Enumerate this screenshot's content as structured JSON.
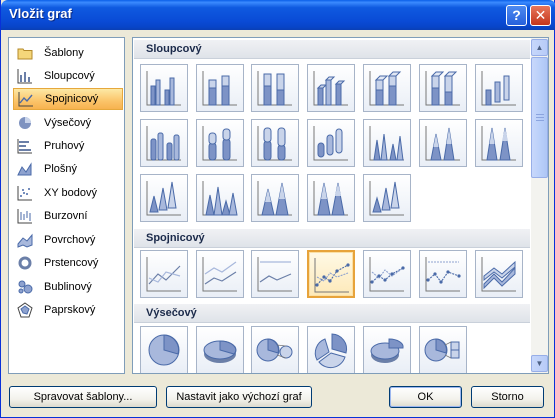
{
  "window": {
    "title": "Vložit graf"
  },
  "titlebar": {
    "help_glyph": "?",
    "close_glyph": "✕"
  },
  "sidebar": {
    "items": [
      {
        "label": "Šablony",
        "icon": "folder-icon"
      },
      {
        "label": "Sloupcový",
        "icon": "column-chart-icon"
      },
      {
        "label": "Spojnicový",
        "icon": "line-chart-icon",
        "selected": true
      },
      {
        "label": "Výsečový",
        "icon": "pie-chart-icon"
      },
      {
        "label": "Pruhový",
        "icon": "bar-chart-icon"
      },
      {
        "label": "Plošný",
        "icon": "area-chart-icon"
      },
      {
        "label": "XY bodový",
        "icon": "scatter-chart-icon"
      },
      {
        "label": "Burzovní",
        "icon": "stock-chart-icon"
      },
      {
        "label": "Povrchový",
        "icon": "surface-chart-icon"
      },
      {
        "label": "Prstencový",
        "icon": "doughnut-chart-icon"
      },
      {
        "label": "Bublinový",
        "icon": "bubble-chart-icon"
      },
      {
        "label": "Paprskový",
        "icon": "radar-chart-icon"
      }
    ]
  },
  "gallery": {
    "sections": [
      {
        "title": "Sloupcový",
        "tiles": [
          "clustered-column-icon",
          "stacked-column-icon",
          "100-stacked-column-icon",
          "3d-clustered-column-icon",
          "3d-stacked-column-icon",
          "3d-100-stacked-column-icon",
          "3d-column-icon",
          "clustered-cylinder-icon",
          "stacked-cylinder-icon",
          "100-stacked-cylinder-icon",
          "3d-cylinder-icon",
          "clustered-cone-icon",
          "stacked-cone-icon",
          "100-stacked-cone-icon",
          "3d-cone-icon",
          "clustered-pyramid-icon",
          "stacked-pyramid-icon",
          "100-stacked-pyramid-icon",
          "3d-pyramid-icon"
        ]
      },
      {
        "title": "Spojnicový",
        "tiles": [
          "line-icon",
          "stacked-line-icon",
          "100-stacked-line-icon",
          "line-with-markers-icon",
          "stacked-line-with-markers-icon",
          "100-stacked-line-with-markers-icon",
          "3d-line-icon"
        ],
        "selected_tile": "line-with-markers-icon"
      },
      {
        "title": "Výsečový",
        "tiles": [
          "pie-icon",
          "3d-pie-icon",
          "pie-of-pie-icon",
          "exploded-pie-icon",
          "3d-exploded-pie-icon",
          "bar-of-pie-icon"
        ]
      }
    ]
  },
  "buttons": {
    "manage_templates": "Spravovat šablony...",
    "set_default": "Nastavit jako výchozí graf",
    "ok": "OK",
    "cancel": "Storno"
  },
  "colors": {
    "accent": "#0a4bd6",
    "selection": "#fbc46a",
    "chart_blue": "#5b7dbf"
  }
}
